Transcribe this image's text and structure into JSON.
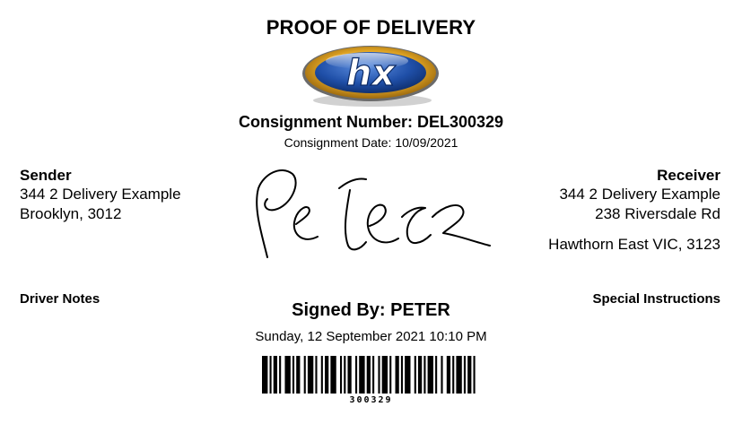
{
  "title": "PROOF OF DELIVERY",
  "logo": {
    "text": "hx",
    "icon": "hx-logo-icon"
  },
  "consignment": {
    "number_label": "Consignment Number: DEL300329",
    "date_label": "Consignment Date: 10/09/2021"
  },
  "sender": {
    "heading": "Sender",
    "line1": "344 2 Delivery Example",
    "line2": "Brooklyn, 3012"
  },
  "receiver": {
    "heading": "Receiver",
    "line1": "344 2 Delivery Example",
    "line2": "238 Riversdale Rd",
    "line3": "Hawthorn East VIC, 3123"
  },
  "signature": {
    "text": "Peter",
    "icon": "handwritten-signature"
  },
  "notes": {
    "driver_label": "Driver Notes",
    "special_label": "Special Instructions"
  },
  "signed": {
    "by_label": "Signed By: PETER",
    "date": "Sunday, 12 September 2021 10:10 PM"
  },
  "barcode": {
    "number": "300329"
  },
  "colors": {
    "logo_blue": "#1f4fa8",
    "logo_gold": "#e3a21a",
    "text": "#000000"
  }
}
